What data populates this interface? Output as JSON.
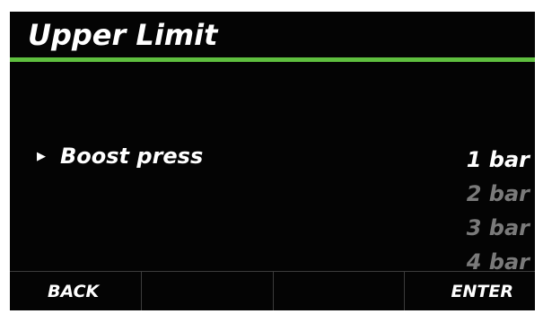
{
  "header": {
    "title": "Upper Limit",
    "accent_color": "#5fbf3f"
  },
  "setting": {
    "pointer_icon": "right-triangle-icon",
    "pointer_glyph": "▶",
    "label": "Boost press"
  },
  "options": [
    {
      "label": "1 bar",
      "selected": true
    },
    {
      "label": "2 bar",
      "selected": false
    },
    {
      "label": "3 bar",
      "selected": false
    },
    {
      "label": "4 bar",
      "selected": false
    }
  ],
  "softkeys": [
    {
      "label": "BACK"
    },
    {
      "label": ""
    },
    {
      "label": ""
    },
    {
      "label": "ENTER"
    }
  ]
}
